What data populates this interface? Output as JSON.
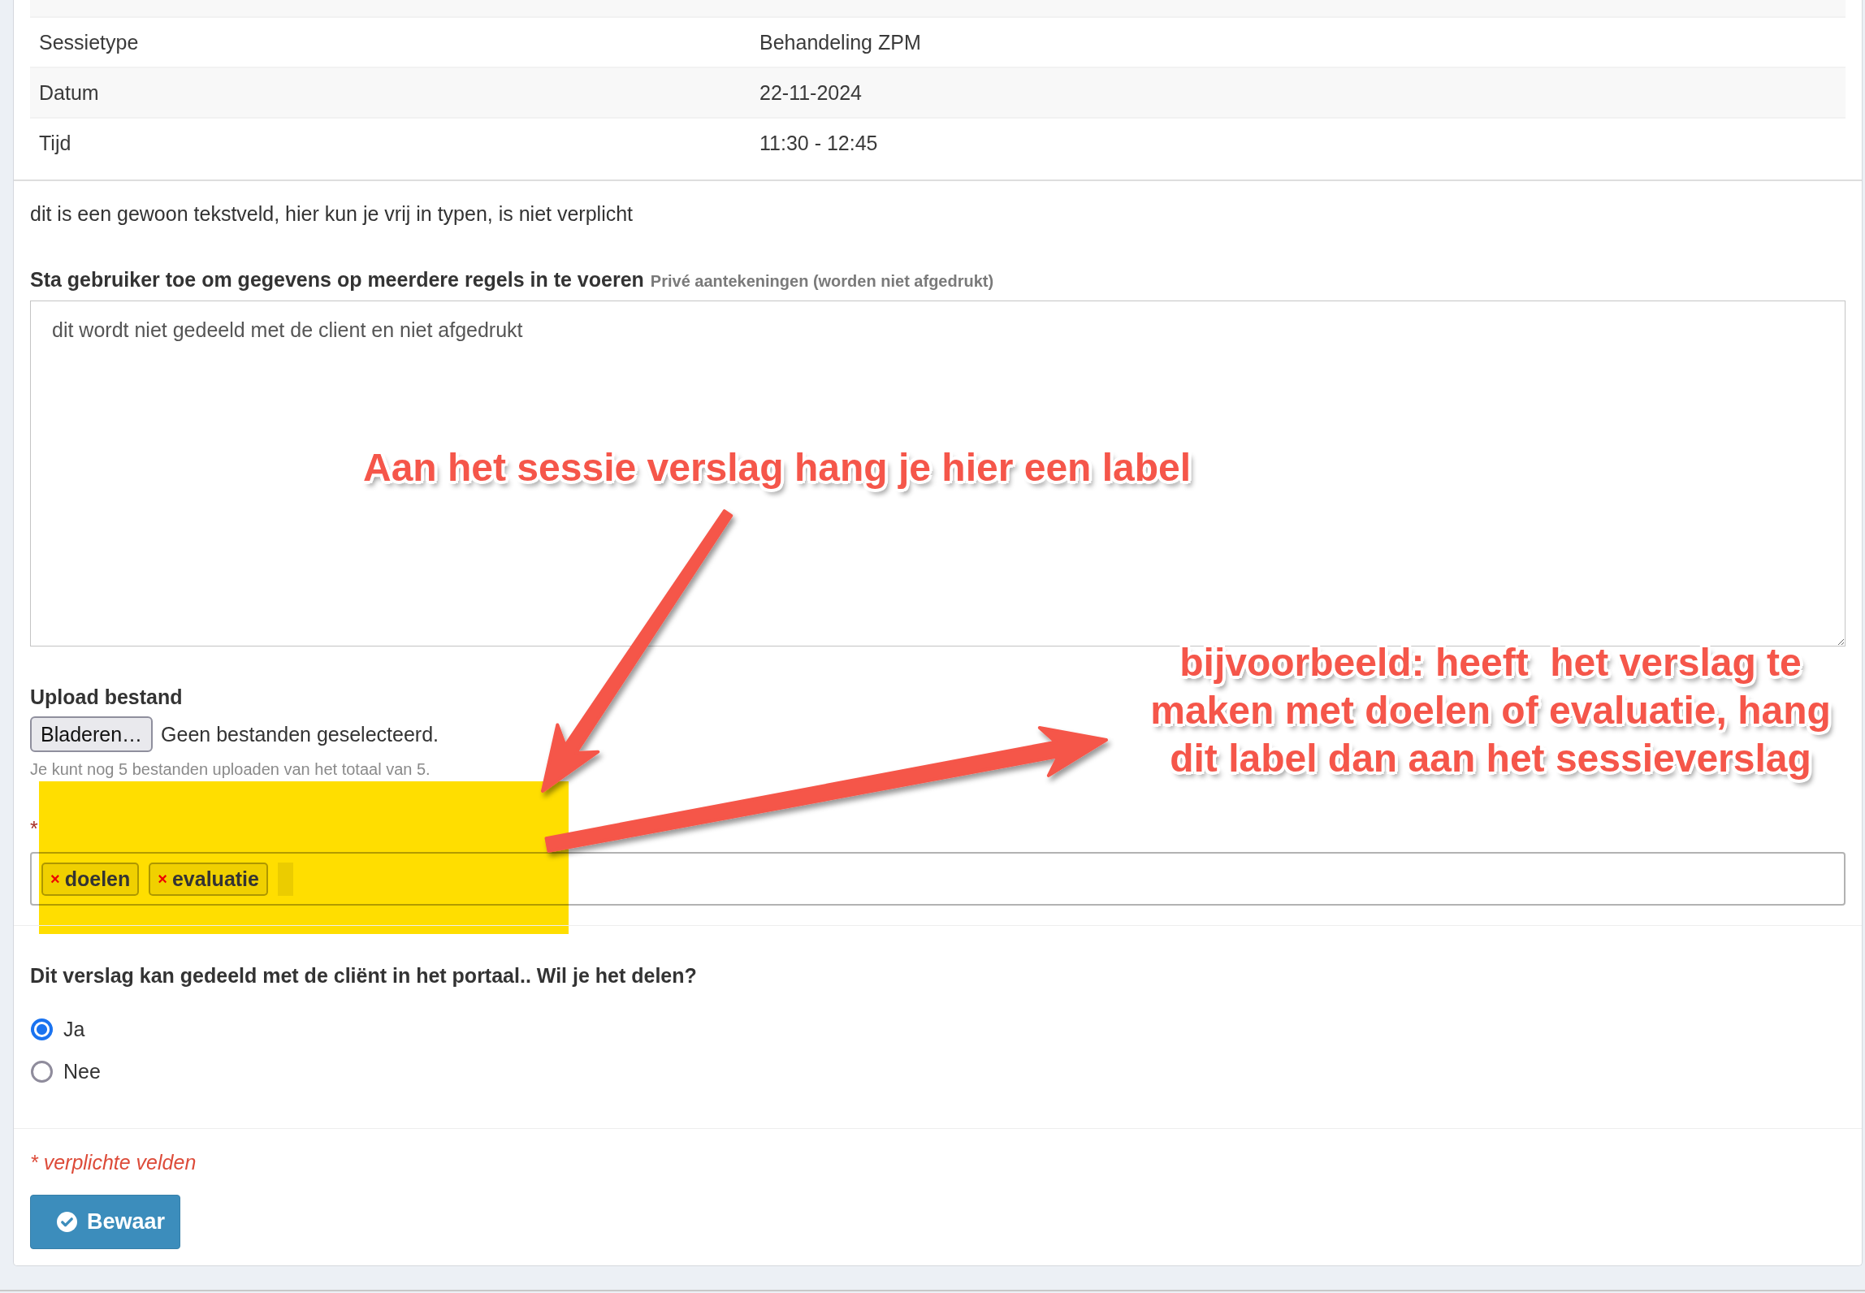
{
  "details_table": {
    "rows": [
      {
        "label": "Sessietype",
        "value": "Behandeling ZPM"
      },
      {
        "label": "Datum",
        "value": "22-11-2024"
      },
      {
        "label": "Tijd",
        "value": "11:30 - 12:45"
      }
    ]
  },
  "free_text": "dit is een gewoon tekstveld, hier kun je vrij in typen, is niet verplicht",
  "notes_field": {
    "label": "Sta gebruiker toe om gegevens op meerdere regels in te voeren",
    "hint": "Privé aantekeningen (worden niet afgedrukt)",
    "value": "dit wordt niet gedeeld met de client en niet afgedrukt"
  },
  "upload": {
    "label": "Upload bestand",
    "button": "Bladeren…",
    "status": "Geen bestanden geselecteerd.",
    "help": "Je kunt nog 5 bestanden uploaden van het totaal van 5."
  },
  "labels_field": {
    "required_mark": "*",
    "tags": [
      {
        "remove": "×",
        "label": "doelen"
      },
      {
        "remove": "×",
        "label": "evaluatie"
      }
    ]
  },
  "share_question": {
    "label": "Dit verslag kan gedeeld met de cliënt in het portaal.. Wil je het delen?",
    "options": [
      {
        "label": "Ja",
        "selected": true
      },
      {
        "label": "Nee",
        "selected": false
      }
    ]
  },
  "required_note": "* verplichte velden",
  "save_button": {
    "label": "Bewaar"
  },
  "annotations": [
    {
      "text": "Aan het sessie verslag hang je hier een label"
    },
    {
      "text": "bijvoorbeeld: heeft  het verslag te maken met doelen of evaluatie, hang dit label dan aan het sessieverslag"
    }
  ]
}
